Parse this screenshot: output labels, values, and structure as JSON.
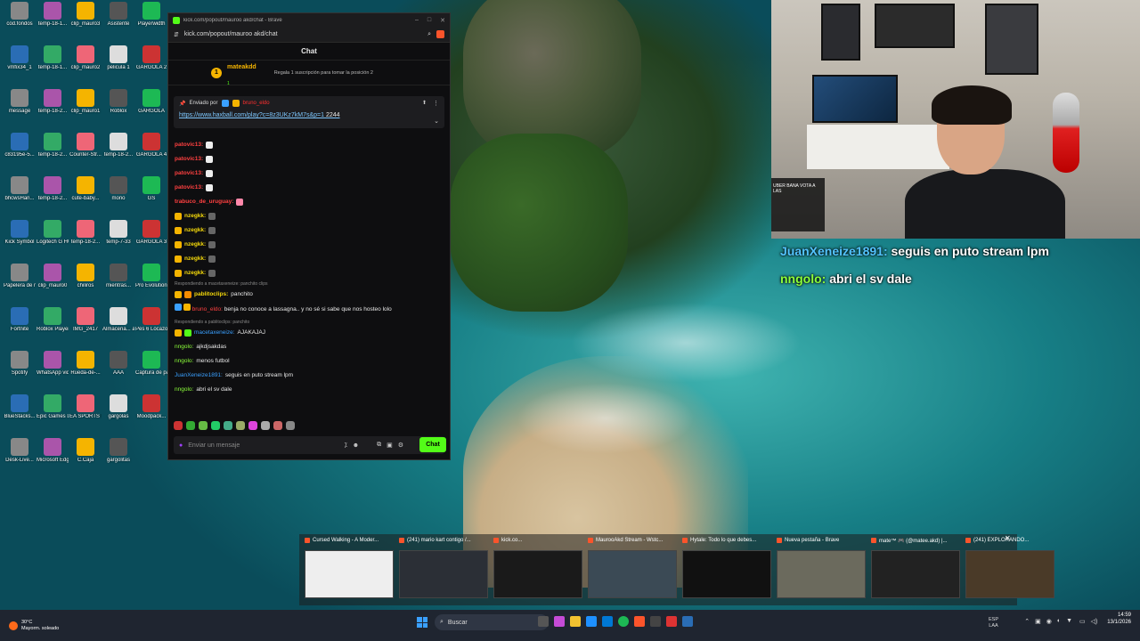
{
  "browser": {
    "tab_title": "kick.com/popout/mauroo akd/chat - Brave",
    "url": "kick.com/popout/mauroo akd/chat",
    "window_controls": [
      "–",
      "□",
      "✕"
    ]
  },
  "chat": {
    "header": "Chat",
    "goal": {
      "rank": "1",
      "username": "mateakdd",
      "count": "1",
      "tip": "Regala 1 suscripción para tomar la posición 2"
    },
    "pinned": {
      "sent_by": "Enviado por",
      "user": "bruno_eldo",
      "link": "https://www.haxball.com/play?c=8z3UKz7kM7s&p=1",
      "link_suffix": "2244"
    },
    "messages": [
      {
        "user": "patovic13:",
        "text": "",
        "color": "#ff4040"
      },
      {
        "user": "patovic13:",
        "text": "",
        "color": "#ff4040"
      },
      {
        "user": "patovic13:",
        "text": "",
        "color": "#ff4040"
      },
      {
        "user": "patovic13:",
        "text": "",
        "color": "#ff4040"
      },
      {
        "user": "trabuco_de_uruguay:",
        "text": "",
        "color": "#ff4040"
      },
      {
        "user": "nzegkk:",
        "text": "",
        "color": "#f5d90a"
      },
      {
        "user": "nzegkk:",
        "text": "",
        "color": "#f5d90a"
      },
      {
        "user": "nzegkk:",
        "text": "",
        "color": "#f5d90a"
      },
      {
        "user": "nzegkk:",
        "text": "",
        "color": "#f5d90a"
      },
      {
        "user": "nzegkk:",
        "text": "",
        "color": "#f5d90a"
      }
    ],
    "reply1": {
      "context": "Respondiendo a macetaxeneize: panchito clips",
      "user": "pablitoclips:",
      "text": "panchito",
      "color": "#f5d90a"
    },
    "msg_bruno": {
      "user": "bruno_eldo:",
      "text": "benja no conoce a lassagna.. y no sé si sabe que nos hosteo lolo",
      "color": "#ff4040"
    },
    "reply2": {
      "context": "Respondiendo a pablitoclips: panchito",
      "user": "macetaxeneize:",
      "text": "AJAKAJAJ",
      "color": "#3aa0ff"
    },
    "tail": [
      {
        "user": "nngolo:",
        "text": "ajkdjsakdas",
        "color": "#8cff3a"
      },
      {
        "user": "nngolo:",
        "text": "menos futbol",
        "color": "#8cff3a"
      },
      {
        "user": "JuanXeneize1891:",
        "text": "seguis en puto stream lpm",
        "color": "#3aa0ff"
      },
      {
        "user": "nngolo:",
        "text": "abri el sv dale",
        "color": "#8cff3a"
      }
    ],
    "input_placeholder": "Enviar un mensaje",
    "send_label": "Chat"
  },
  "stream_overlay": {
    "line1_user": "JuanXeneize1891:",
    "line1_text": "seguis en puto stream lpm",
    "line2_user": "nngolo:",
    "line2_text": "abri el sv dale",
    "cam_chat": "UBER BANA VOTA A LAS"
  },
  "desktop_icons": [
    {
      "label": "cod.fondos"
    },
    {
      "label": "temp-18-1..."
    },
    {
      "label": "clip_mauro3"
    },
    {
      "label": "Asistente"
    },
    {
      "label": "Playerwidth"
    },
    {
      "label": "vmfix34_1"
    },
    {
      "label": "temp-18-1..."
    },
    {
      "label": "clip_mauro2"
    },
    {
      "label": "pelicula 1"
    },
    {
      "label": "GARGOLA 2"
    },
    {
      "label": "message"
    },
    {
      "label": "temp-18-2..."
    },
    {
      "label": "clip_mauro1"
    },
    {
      "label": "Roblox"
    },
    {
      "label": "GARGOLA"
    },
    {
      "label": "c83195e-5..."
    },
    {
      "label": "temp-18-2..."
    },
    {
      "label": "Counter-Str..."
    },
    {
      "label": "temp-18-2..."
    },
    {
      "label": "GARGOLA 4"
    },
    {
      "label": "bhcwsHan..."
    },
    {
      "label": "temp-18-2..."
    },
    {
      "label": "cute-baby..."
    },
    {
      "label": "mono"
    },
    {
      "label": "GS"
    },
    {
      "label": "Kick Symbol"
    },
    {
      "label": "Logitech G HUB"
    },
    {
      "label": "temp-18-2..."
    },
    {
      "label": "temp-7-33"
    },
    {
      "label": "GARGOLA 3"
    },
    {
      "label": "Papelera de reciclaje"
    },
    {
      "label": "clip_mauro0"
    },
    {
      "label": "chiliros"
    },
    {
      "label": "mientras..."
    },
    {
      "label": "Pro Evolution Soccer 6"
    },
    {
      "label": "Fortnite"
    },
    {
      "label": "Roblox Player"
    },
    {
      "label": "IMG_2417"
    },
    {
      "label": "Almacena... automatic..."
    },
    {
      "label": "Pes 6 Locazos"
    },
    {
      "label": "Spotify"
    },
    {
      "label": "WhatsApp video 2025-..."
    },
    {
      "label": "Rueda-de-..."
    },
    {
      "label": "AAA"
    },
    {
      "label": "Captura de pantalla ..."
    },
    {
      "label": "BlueStacks..."
    },
    {
      "label": "Epic Games Launcher"
    },
    {
      "label": "EA SPORTS FC™ 26"
    },
    {
      "label": "gargolas"
    },
    {
      "label": "Moodpack..."
    },
    {
      "label": "Desk-Live..."
    },
    {
      "label": "Microsoft Edge"
    },
    {
      "label": "C.Caja"
    },
    {
      "label": "gargolitas"
    }
  ],
  "taskbar_previews": [
    {
      "title": "Cursed Walking - A Moder..."
    },
    {
      "title": "(241) mario kart contigo /..."
    },
    {
      "title": "kick.co..."
    },
    {
      "title": "MaurooAkd Stream - Wstc..."
    },
    {
      "title": "Hytale: Todo lo que debes..."
    },
    {
      "title": "Nueva pestaña - Brave"
    },
    {
      "title": "mate™ 🎮 (@matee.akd) |..."
    },
    {
      "title": "(241) EXPLORANDO..."
    }
  ],
  "taskbar": {
    "weather_temp": "30°C",
    "weather_desc": "Mayorm. soleado",
    "search_placeholder": "Buscar",
    "lang_line1": "ESP",
    "lang_line2": "LAA",
    "time": "14:59",
    "date": "13/1/2026"
  },
  "colors": {
    "kick_green": "#53fc18",
    "brave_orange": "#fb542b",
    "taskbar": "#1f2530"
  }
}
